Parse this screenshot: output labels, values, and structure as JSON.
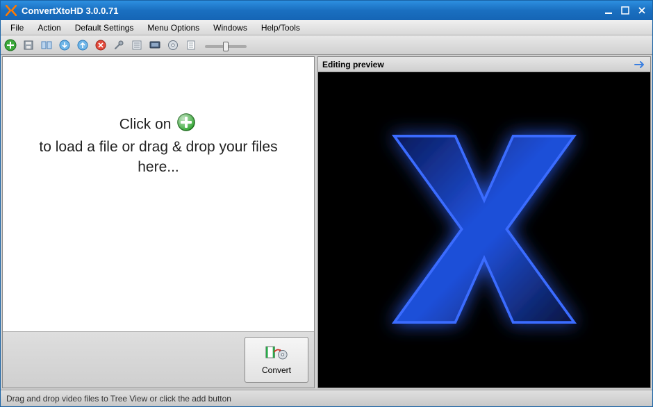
{
  "window": {
    "title": "ConvertXtoHD 3.0.0.71"
  },
  "menu": {
    "file": "File",
    "action": "Action",
    "default_settings": "Default Settings",
    "menu_options": "Menu Options",
    "windows": "Windows",
    "help_tools": "Help/Tools"
  },
  "toolbar": {
    "icons": {
      "add": "add",
      "save": "save",
      "title_menu": "title-menu",
      "down": "down",
      "up": "up",
      "cancel": "cancel",
      "settings": "settings",
      "list": "list",
      "preview_mode": "preview-mode",
      "burn": "burn",
      "log": "log"
    }
  },
  "dropzone": {
    "line1_pre": "Click on ",
    "line1_post": "",
    "line2": "to load a file or drag & drop your files here..."
  },
  "convert": {
    "label": "Convert"
  },
  "preview": {
    "title": "Editing preview"
  },
  "statusbar": {
    "text": "Drag and drop video files to Tree View or click the add button"
  },
  "colors": {
    "titlebar": "#1a6fc0",
    "accent_green": "#3aa93a",
    "accent_red": "#e34b3d",
    "preview_blue": "#1f4fd8"
  }
}
